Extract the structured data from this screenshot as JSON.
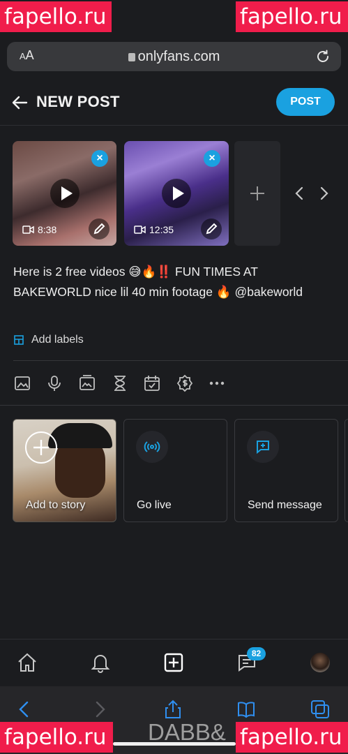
{
  "watermarks": {
    "top_left": "fapello.ru",
    "top_right": "fapello.ru",
    "bottom_left": "fapello.ru",
    "bottom_right": "fapello.ru"
  },
  "browser": {
    "text_size_label_small": "A",
    "text_size_label_large": "A",
    "url": "onlyfans.com"
  },
  "header": {
    "title": "NEW POST",
    "post_button": "POST"
  },
  "media": [
    {
      "duration": "8:38",
      "remove": "×"
    },
    {
      "duration": "12:35",
      "remove": "×"
    }
  ],
  "post_text": "Here is 2 free videos 😅🔥‼️  FUN TIMES AT BAKEWORLD nice lil 40 min footage 🔥 @bakeworld",
  "labels_action": "Add labels",
  "toolbar_icons": [
    "image-icon",
    "microphone-icon",
    "vault-icon",
    "hourglass-icon",
    "calendar-icon",
    "price-icon",
    "more-icon"
  ],
  "cards": [
    {
      "label": "Add to story"
    },
    {
      "label": "Go live"
    },
    {
      "label": "Send message"
    }
  ],
  "bottom_nav": {
    "messages_badge": "82"
  },
  "signature_text": "DABB&",
  "colors": {
    "accent": "#1aa1e0",
    "background": "#1b1c1f",
    "watermark": "#f01d4b"
  }
}
